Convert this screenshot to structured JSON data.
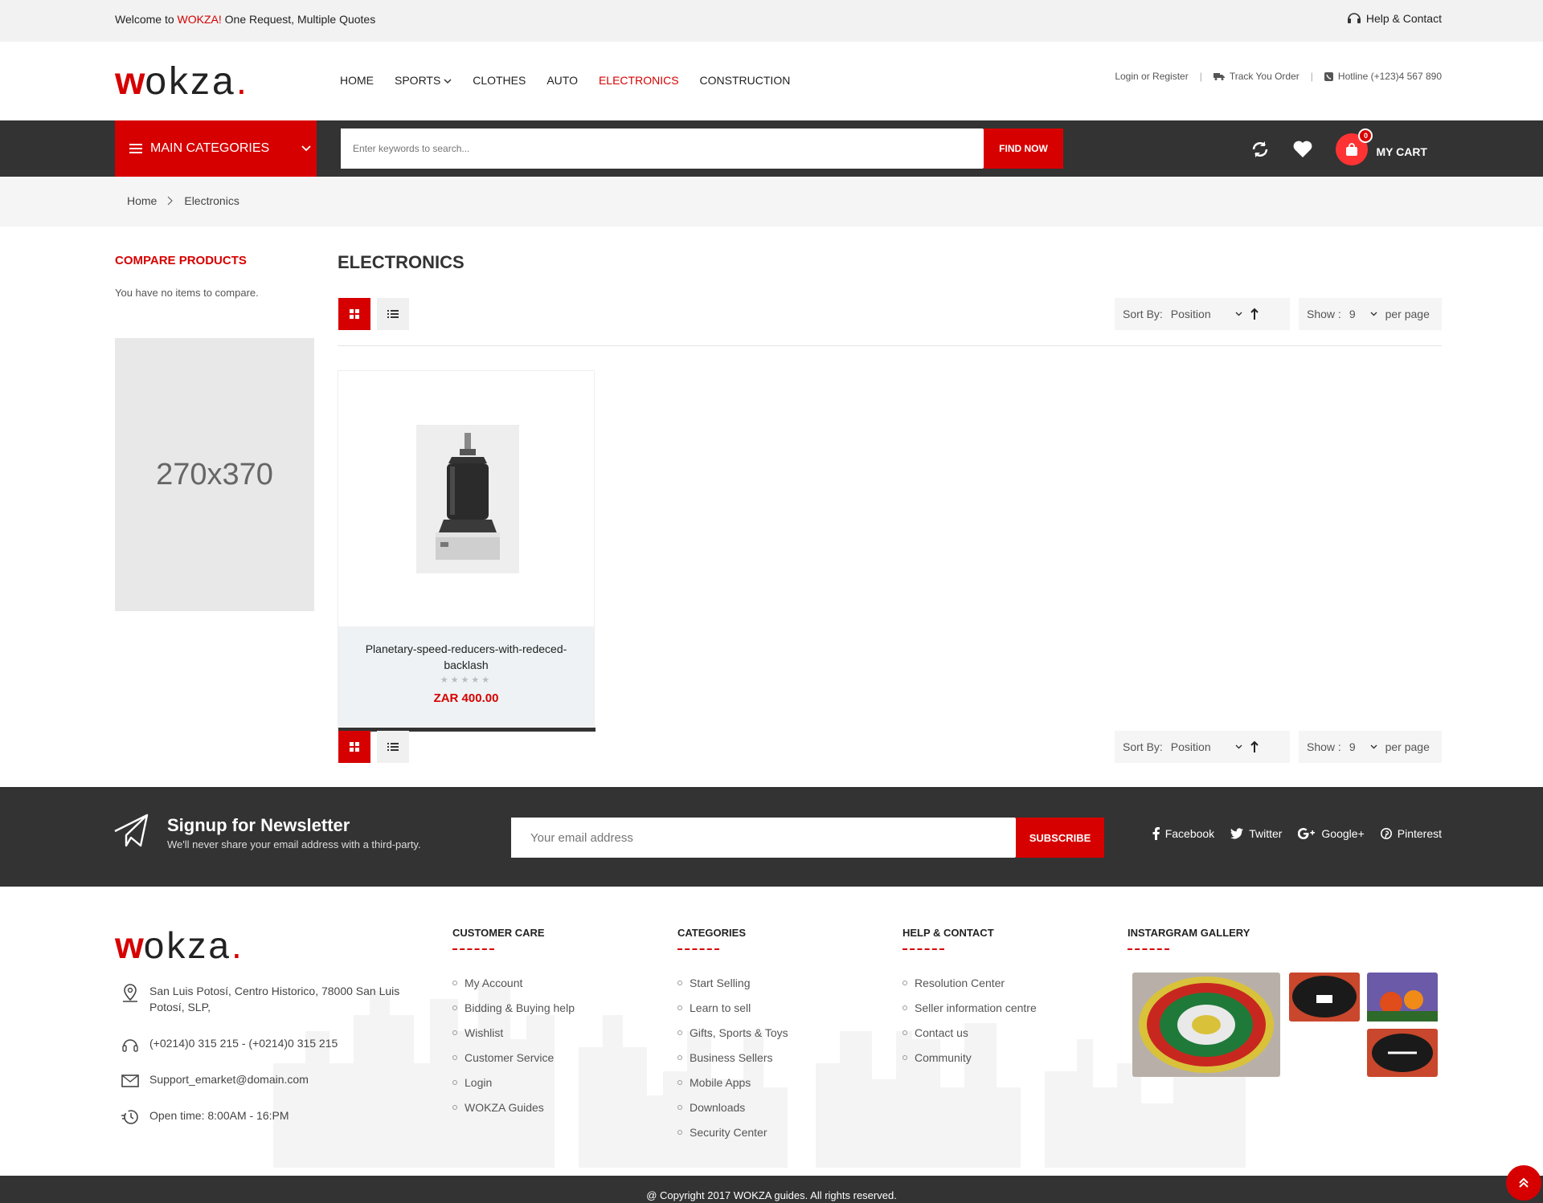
{
  "topbar": {
    "welcome_prefix": "Welcome to ",
    "welcome_brand": "WOKZA!",
    "welcome_suffix": " One Request, Multiple Quotes",
    "help": "Help & Contact"
  },
  "logo": {
    "w": "w",
    "rest": "okza",
    "dot": "."
  },
  "nav": {
    "items": [
      "HOME",
      "SPORTS",
      "CLOTHES",
      "AUTO",
      "ELECTRONICS",
      "CONSTRUCTION"
    ],
    "active": "ELECTRONICS"
  },
  "header_links": {
    "login": "Login or Register",
    "track": "Track You Order",
    "hotline": "Hotline (+123)4 567 890"
  },
  "catbar": {
    "main_categories": "MAIN CATEGORIES",
    "search_placeholder": "Enter keywords to search...",
    "find_now": "FIND NOW",
    "cart_label": "MY CART",
    "cart_count": "0"
  },
  "breadcrumb": [
    "Home",
    "Electronics"
  ],
  "sidebar": {
    "title": "COMPARE PRODUCTS",
    "text": "You have no items to compare.",
    "banner": "270x370"
  },
  "main": {
    "title": "ELECTRONICS",
    "sort_label": "Sort By:",
    "sort_value": "Position",
    "show_label": "Show :",
    "show_value": "9",
    "per_page": "per page"
  },
  "product": {
    "name": "Planetary-speed-reducers-with-redeced-backlash",
    "price": "ZAR 400.00",
    "rating": 0,
    "rating_max": 5
  },
  "newsletter": {
    "title": "Signup for Newsletter",
    "subtitle": "We'll never share your email address with a third-party.",
    "placeholder": "Your email address",
    "button": "SUBSCRIBE",
    "social": [
      "Facebook",
      "Twitter",
      "Google+",
      "Pinterest"
    ]
  },
  "footer": {
    "address": "San Luis Potosí, Centro Historico, 78000 San Luis Potosí, SLP,",
    "phone": "(+0214)0 315 215 - (+0214)0 315 215",
    "email": "Support_emarket@domain.com",
    "hours": "Open time: 8:00AM - 16:PM",
    "customer_care": {
      "title": "CUSTOMER CARE",
      "items": [
        "My Account",
        "Bidding & Buying help",
        "Wishlist",
        "Customer Service",
        "Login",
        "WOKZA Guides"
      ]
    },
    "categories": {
      "title": "CATEGORIES",
      "items": [
        "Start Selling",
        "Learn to sell",
        "Gifts, Sports & Toys",
        "Business Sellers",
        "Mobile Apps",
        "Downloads",
        "Security Center"
      ]
    },
    "help_contact": {
      "title": "HELP & CONTACT",
      "items": [
        "Resolution Center",
        "Seller information centre",
        "Contact us",
        "Community"
      ]
    },
    "gallery": {
      "title": "INSTARGRAM GALLERY"
    },
    "copyright": "@ Copyright 2017 WOKZA guides. All rights reserved."
  },
  "colors": {
    "accent": "#d60000",
    "dark": "#333333",
    "light_bg": "#f5f5f5"
  }
}
